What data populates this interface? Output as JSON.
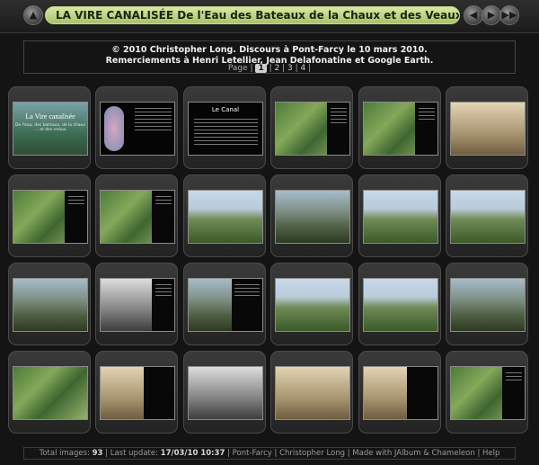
{
  "title": "LA VIRE CANALISÉE De l'Eau des Bateaux de la Chaux et des Veaux",
  "info": {
    "line1": "© 2010 Christopher Long. Discours à Pont-Farcy le 10 mars 2010.",
    "line2": "Remerciements à Henri Letellier, Jean Delafonatine et Google Earth."
  },
  "pager": {
    "label": "Page",
    "current": "1",
    "pages": [
      "2",
      "3",
      "4"
    ]
  },
  "thumbs": {
    "t0": {
      "title": "La Vire canalisée",
      "subtitle": "De l'eau, des bateaux, de la chaux ... et des veaux"
    },
    "t2": {
      "title": "Le Canal"
    }
  },
  "footer": {
    "total_label": "Total images:",
    "total": "93",
    "update_label": "Last update:",
    "update": "17/03/10 10:37",
    "link1": "Pont-Farcy",
    "link2": "Christopher Long",
    "made": "Made with JAlbum & Chameleon",
    "help": "Help"
  },
  "icons": {
    "up": "up-arrow-icon",
    "prev": "prev-arrow-icon",
    "play": "play-icon",
    "next": "next-arrow-icon"
  }
}
